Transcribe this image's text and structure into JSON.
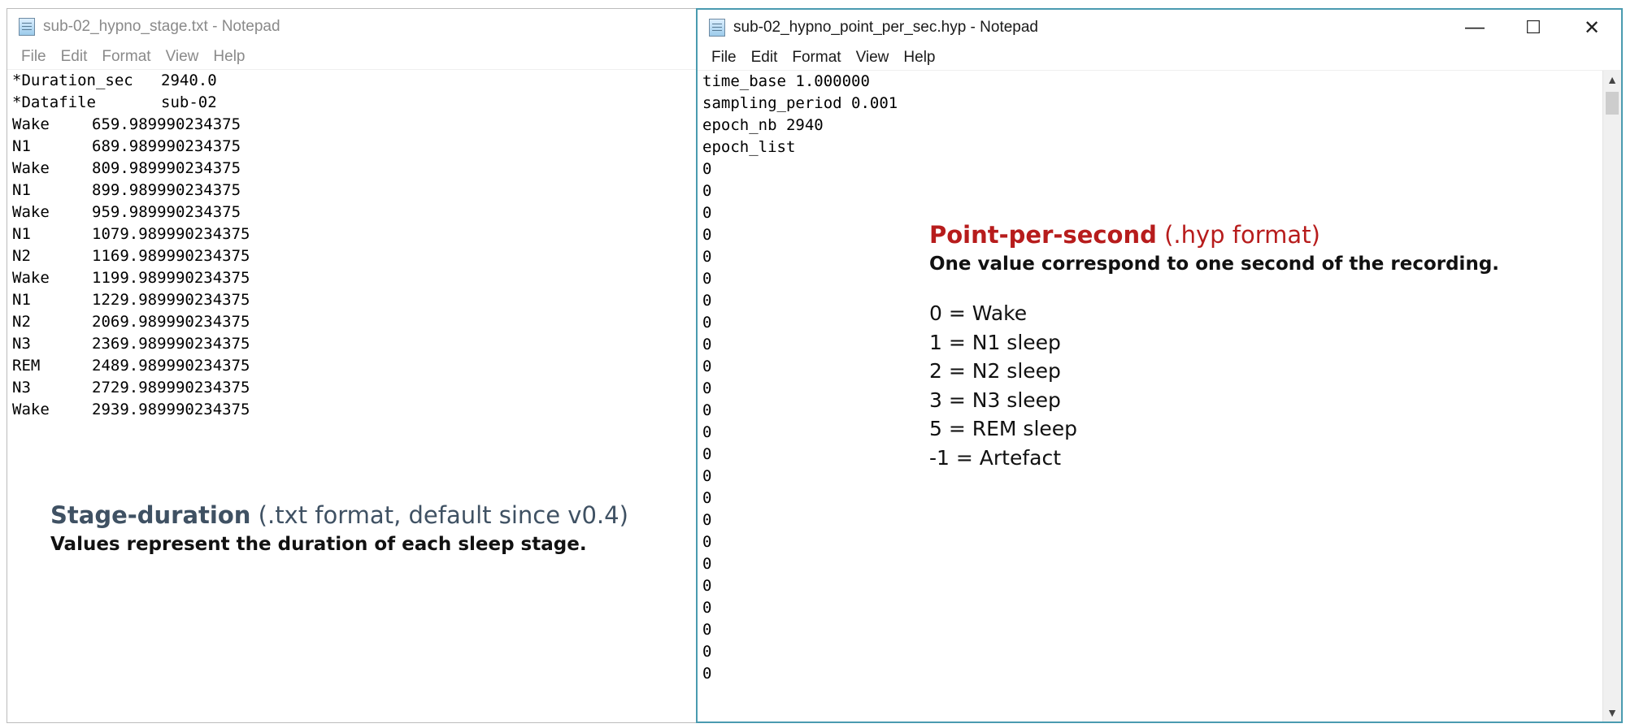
{
  "left_window": {
    "title": "sub-02_hypno_stage.txt - Notepad",
    "menu": [
      "File",
      "Edit",
      "Format",
      "View",
      "Help"
    ],
    "header_lines": [
      "*Duration_sec   2940.0",
      "*Datafile       sub-02"
    ],
    "stages": [
      {
        "stage": "Wake",
        "time": "659.989990234375"
      },
      {
        "stage": "N1",
        "time": "689.989990234375"
      },
      {
        "stage": "Wake",
        "time": "809.989990234375"
      },
      {
        "stage": "N1",
        "time": "899.989990234375"
      },
      {
        "stage": "Wake",
        "time": "959.989990234375"
      },
      {
        "stage": "N1",
        "time": "1079.989990234375"
      },
      {
        "stage": "N2",
        "time": "1169.989990234375"
      },
      {
        "stage": "Wake",
        "time": "1199.989990234375"
      },
      {
        "stage": "N1",
        "time": "1229.989990234375"
      },
      {
        "stage": "N2",
        "time": "2069.989990234375"
      },
      {
        "stage": "N3",
        "time": "2369.989990234375"
      },
      {
        "stage": "REM",
        "time": "2489.989990234375"
      },
      {
        "stage": "N3",
        "time": "2729.989990234375"
      },
      {
        "stage": "Wake",
        "time": "2939.989990234375"
      }
    ]
  },
  "right_window": {
    "title": "sub-02_hypno_point_per_sec.hyp - Notepad",
    "menu": [
      "File",
      "Edit",
      "Format",
      "View",
      "Help"
    ],
    "controls": {
      "minimize": "—",
      "maximize": "☐",
      "close": "✕"
    },
    "lines": [
      "time_base 1.000000",
      "sampling_period 0.001",
      "epoch_nb 2940",
      "epoch_list",
      "0",
      "0",
      "0",
      "0",
      "0",
      "0",
      "0",
      "0",
      "0",
      "0",
      "0",
      "0",
      "0",
      "0",
      "0",
      "0",
      "0",
      "0",
      "0",
      "0",
      "0",
      "0",
      "0",
      "0"
    ]
  },
  "annotations": {
    "stage_duration": {
      "title_bold": "Stage-duration",
      "title_rest": " (.txt format, default since v0.4)",
      "subtitle": "Values represent the duration of each sleep stage."
    },
    "point_per_second": {
      "title_bold": "Point-per-second",
      "title_rest": " (.hyp format)",
      "subtitle": "One value correspond to one second of the recording.",
      "legend": [
        "0 = Wake",
        "1 = N1 sleep",
        "2 = N2 sleep",
        "3 = N3 sleep",
        "5 = REM sleep",
        "-1 = Artefact"
      ]
    }
  },
  "colors": {
    "stage_duration_title": "#3f5163",
    "point_per_second_title": "#b71c1c",
    "active_window_border": "#4a9bb0"
  },
  "icons": {
    "app_icon": "notepad-icon",
    "scroll_up": "▲",
    "scroll_down": "▼"
  }
}
